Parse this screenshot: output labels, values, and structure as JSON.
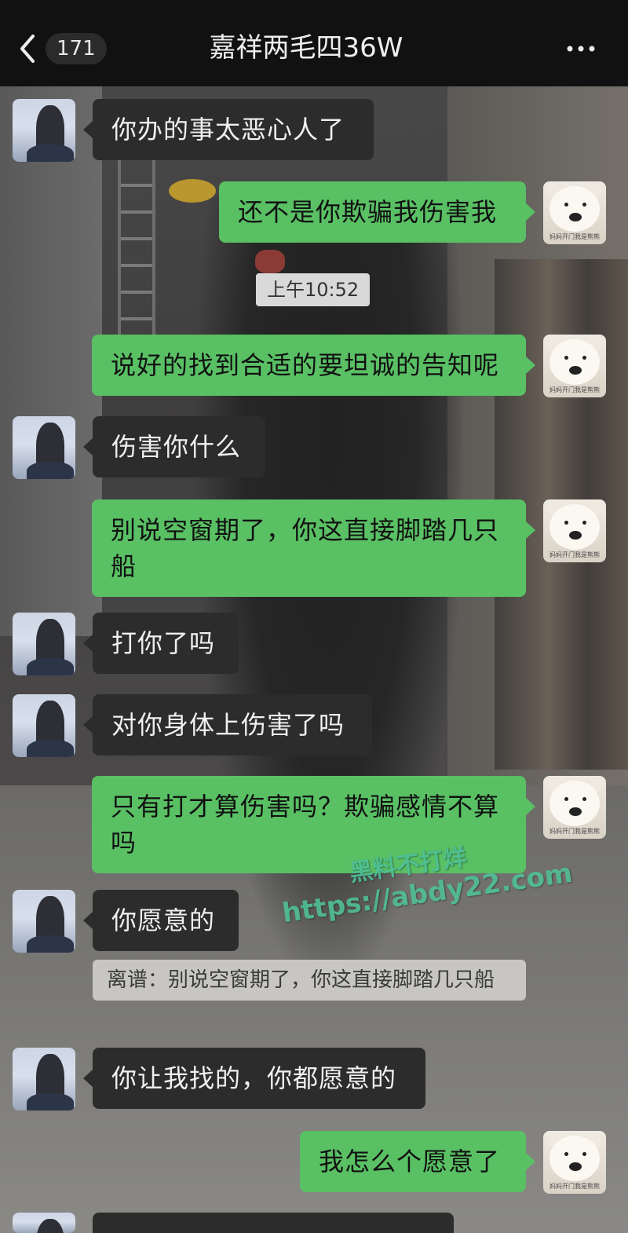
{
  "header": {
    "back_icon": "chevron-left-icon",
    "unread_count": "171",
    "title": "嘉祥两毛四36W",
    "more_icon": "more-horizontal-icon"
  },
  "colors": {
    "header_bg": "#111111",
    "bubble_self": "#59c064",
    "bubble_other": "#2c2c2c",
    "timestamp_bg": "#d9d9d9"
  },
  "avatars": {
    "self_caption": "妈妈开门我是熊熊"
  },
  "timestamp": "上午10:52",
  "messages": [
    {
      "side": "left",
      "text": "你办的事太恶心人了"
    },
    {
      "side": "right",
      "text": "还不是你欺骗我伤害我"
    },
    {
      "side": "right",
      "text": "说好的找到合适的要坦诚的告知呢"
    },
    {
      "side": "left",
      "text": "伤害你什么"
    },
    {
      "side": "right",
      "text": "别说空窗期了，你这直接脚踏几只船"
    },
    {
      "side": "left",
      "text": "打你了吗"
    },
    {
      "side": "left",
      "text": "对你身体上伤害了吗"
    },
    {
      "side": "right",
      "text": "只有打才算伤害吗？欺骗感情不算吗"
    },
    {
      "side": "left",
      "text": "你愿意的"
    },
    {
      "side": "left",
      "text": "你让我找的，你都愿意的"
    },
    {
      "side": "right",
      "text": "我怎么个愿意了"
    }
  ],
  "quote": "离谱：别说空窗期了，你这直接脚踏几只船",
  "watermark": {
    "line1": "黑料不打烊",
    "line2": "https://abdy22.com"
  }
}
